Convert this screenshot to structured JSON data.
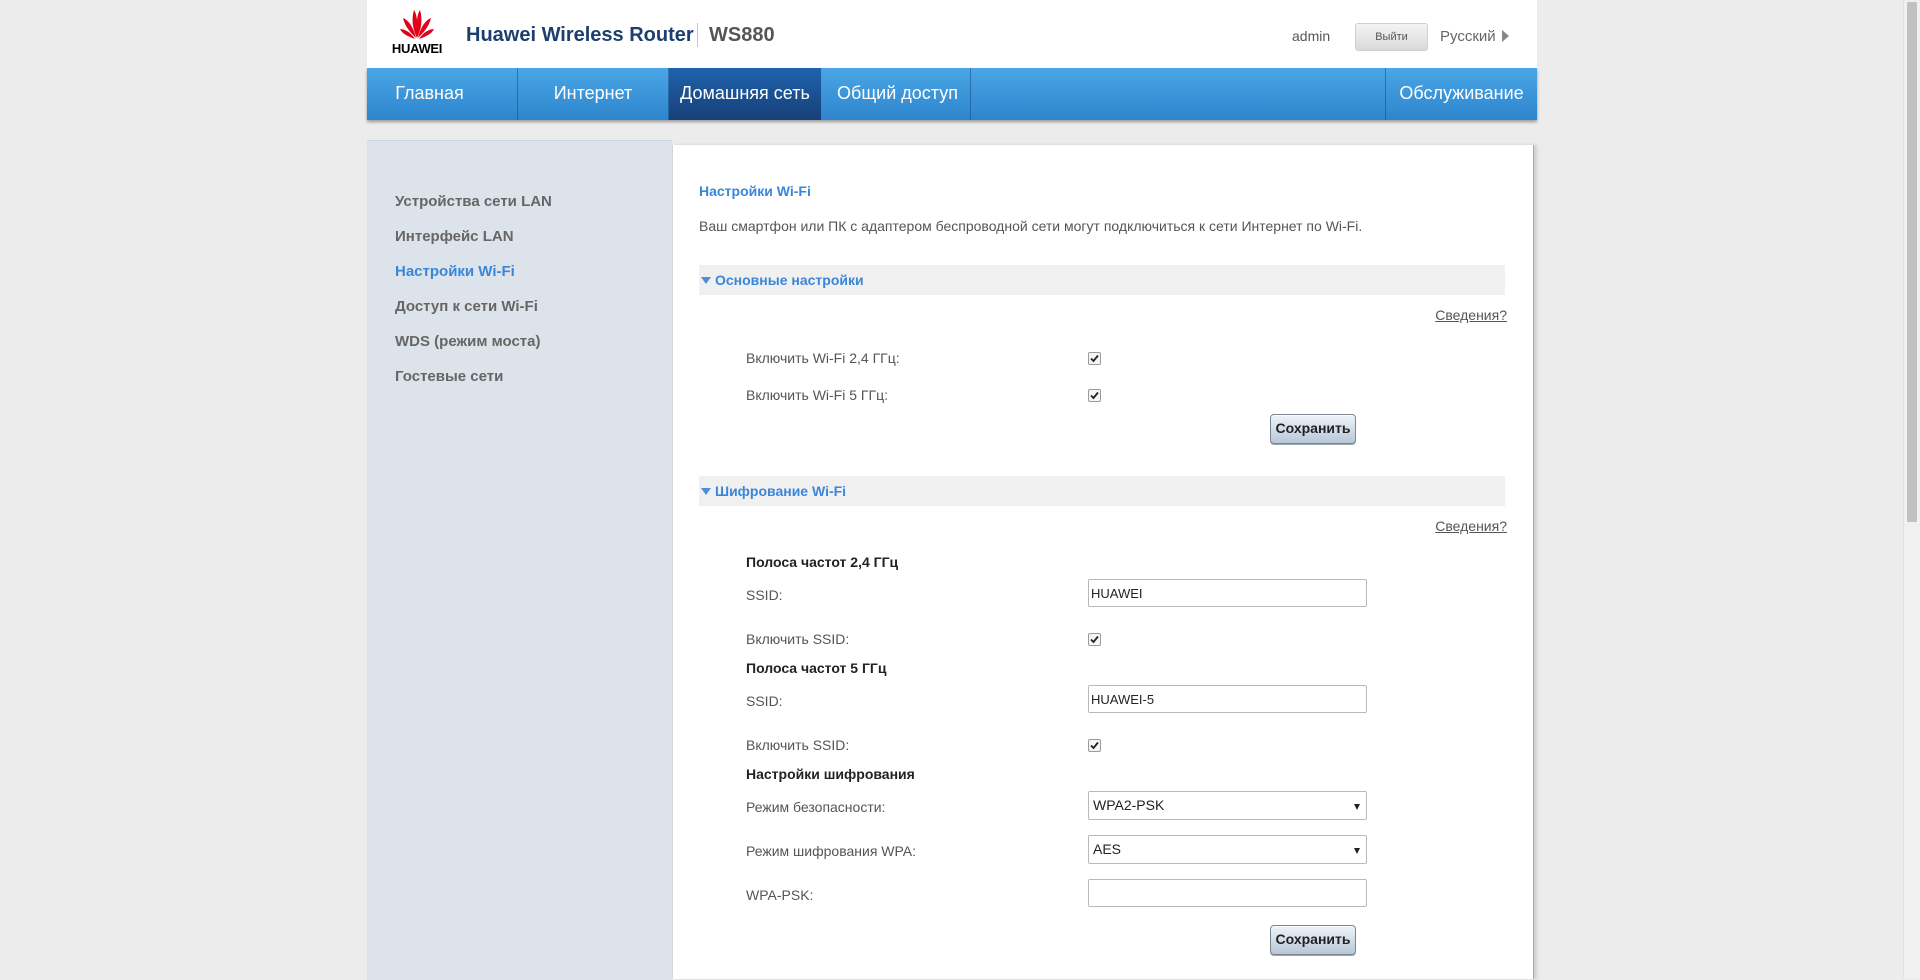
{
  "header": {
    "logo_text": "HUAWEI",
    "product_title": "Huawei Wireless Router",
    "model": "WS880",
    "user": "admin",
    "logout_label": "Выйти",
    "language": "Русский"
  },
  "nav": {
    "items": [
      {
        "label": "Главная"
      },
      {
        "label": "Интернет"
      },
      {
        "label": "Домашняя сеть",
        "active": true
      },
      {
        "label": "Общий доступ"
      },
      {
        "label": "Обслуживание"
      }
    ]
  },
  "sidebar": {
    "items": [
      {
        "label": "Устройства сети LAN"
      },
      {
        "label": "Интерфейс LAN"
      },
      {
        "label": "Настройки Wi-Fi",
        "active": true
      },
      {
        "label": "Доступ к сети Wi-Fi"
      },
      {
        "label": "WDS (режим моста)"
      },
      {
        "label": "Гостевые сети"
      }
    ]
  },
  "content": {
    "title": "Настройки Wi-Fi",
    "description": "Ваш смартфон или ПК с адаптером беспроводной сети могут подключиться к сети Интернет по Wi-Fi.",
    "basic": {
      "section_title": "Основные настройки",
      "info_link": "Сведения?",
      "wifi24_label": "Включить Wi-Fi 2,4 ГГц:",
      "wifi24_enabled": true,
      "wifi5_label": "Включить Wi-Fi 5 ГГц:",
      "wifi5_enabled": true,
      "save_label": "Сохранить"
    },
    "encryption": {
      "section_title": "Шифрование Wi-Fi",
      "info_link": "Сведения?",
      "band24_heading": "Полоса частот 2,4 ГГц",
      "band24_ssid_label": "SSID:",
      "band24_ssid_value": "HUAWEI",
      "band24_enable_label": "Включить SSID:",
      "band24_enabled": true,
      "band5_heading": "Полоса частот 5 ГГц",
      "band5_ssid_label": "SSID:",
      "band5_ssid_value": "HUAWEI-5",
      "band5_enable_label": "Включить SSID:",
      "band5_enabled": true,
      "settings_heading": "Настройки шифрования",
      "security_mode_label": "Режим безопасности:",
      "security_mode_value": "WPA2-PSK",
      "wpa_mode_label": "Режим шифрования WPA:",
      "wpa_mode_value": "AES",
      "psk_label": "WPA-PSK:",
      "psk_value": "",
      "save_label": "Сохранить"
    }
  },
  "colors": {
    "nav_gradient_top": "#4aa6e6",
    "nav_gradient_bottom": "#2e85cc",
    "nav_active": "#1f63ad",
    "accent_link": "#3a86d8",
    "brand_red": "#e4001b",
    "sidebar_bg": "#dde3ea"
  }
}
